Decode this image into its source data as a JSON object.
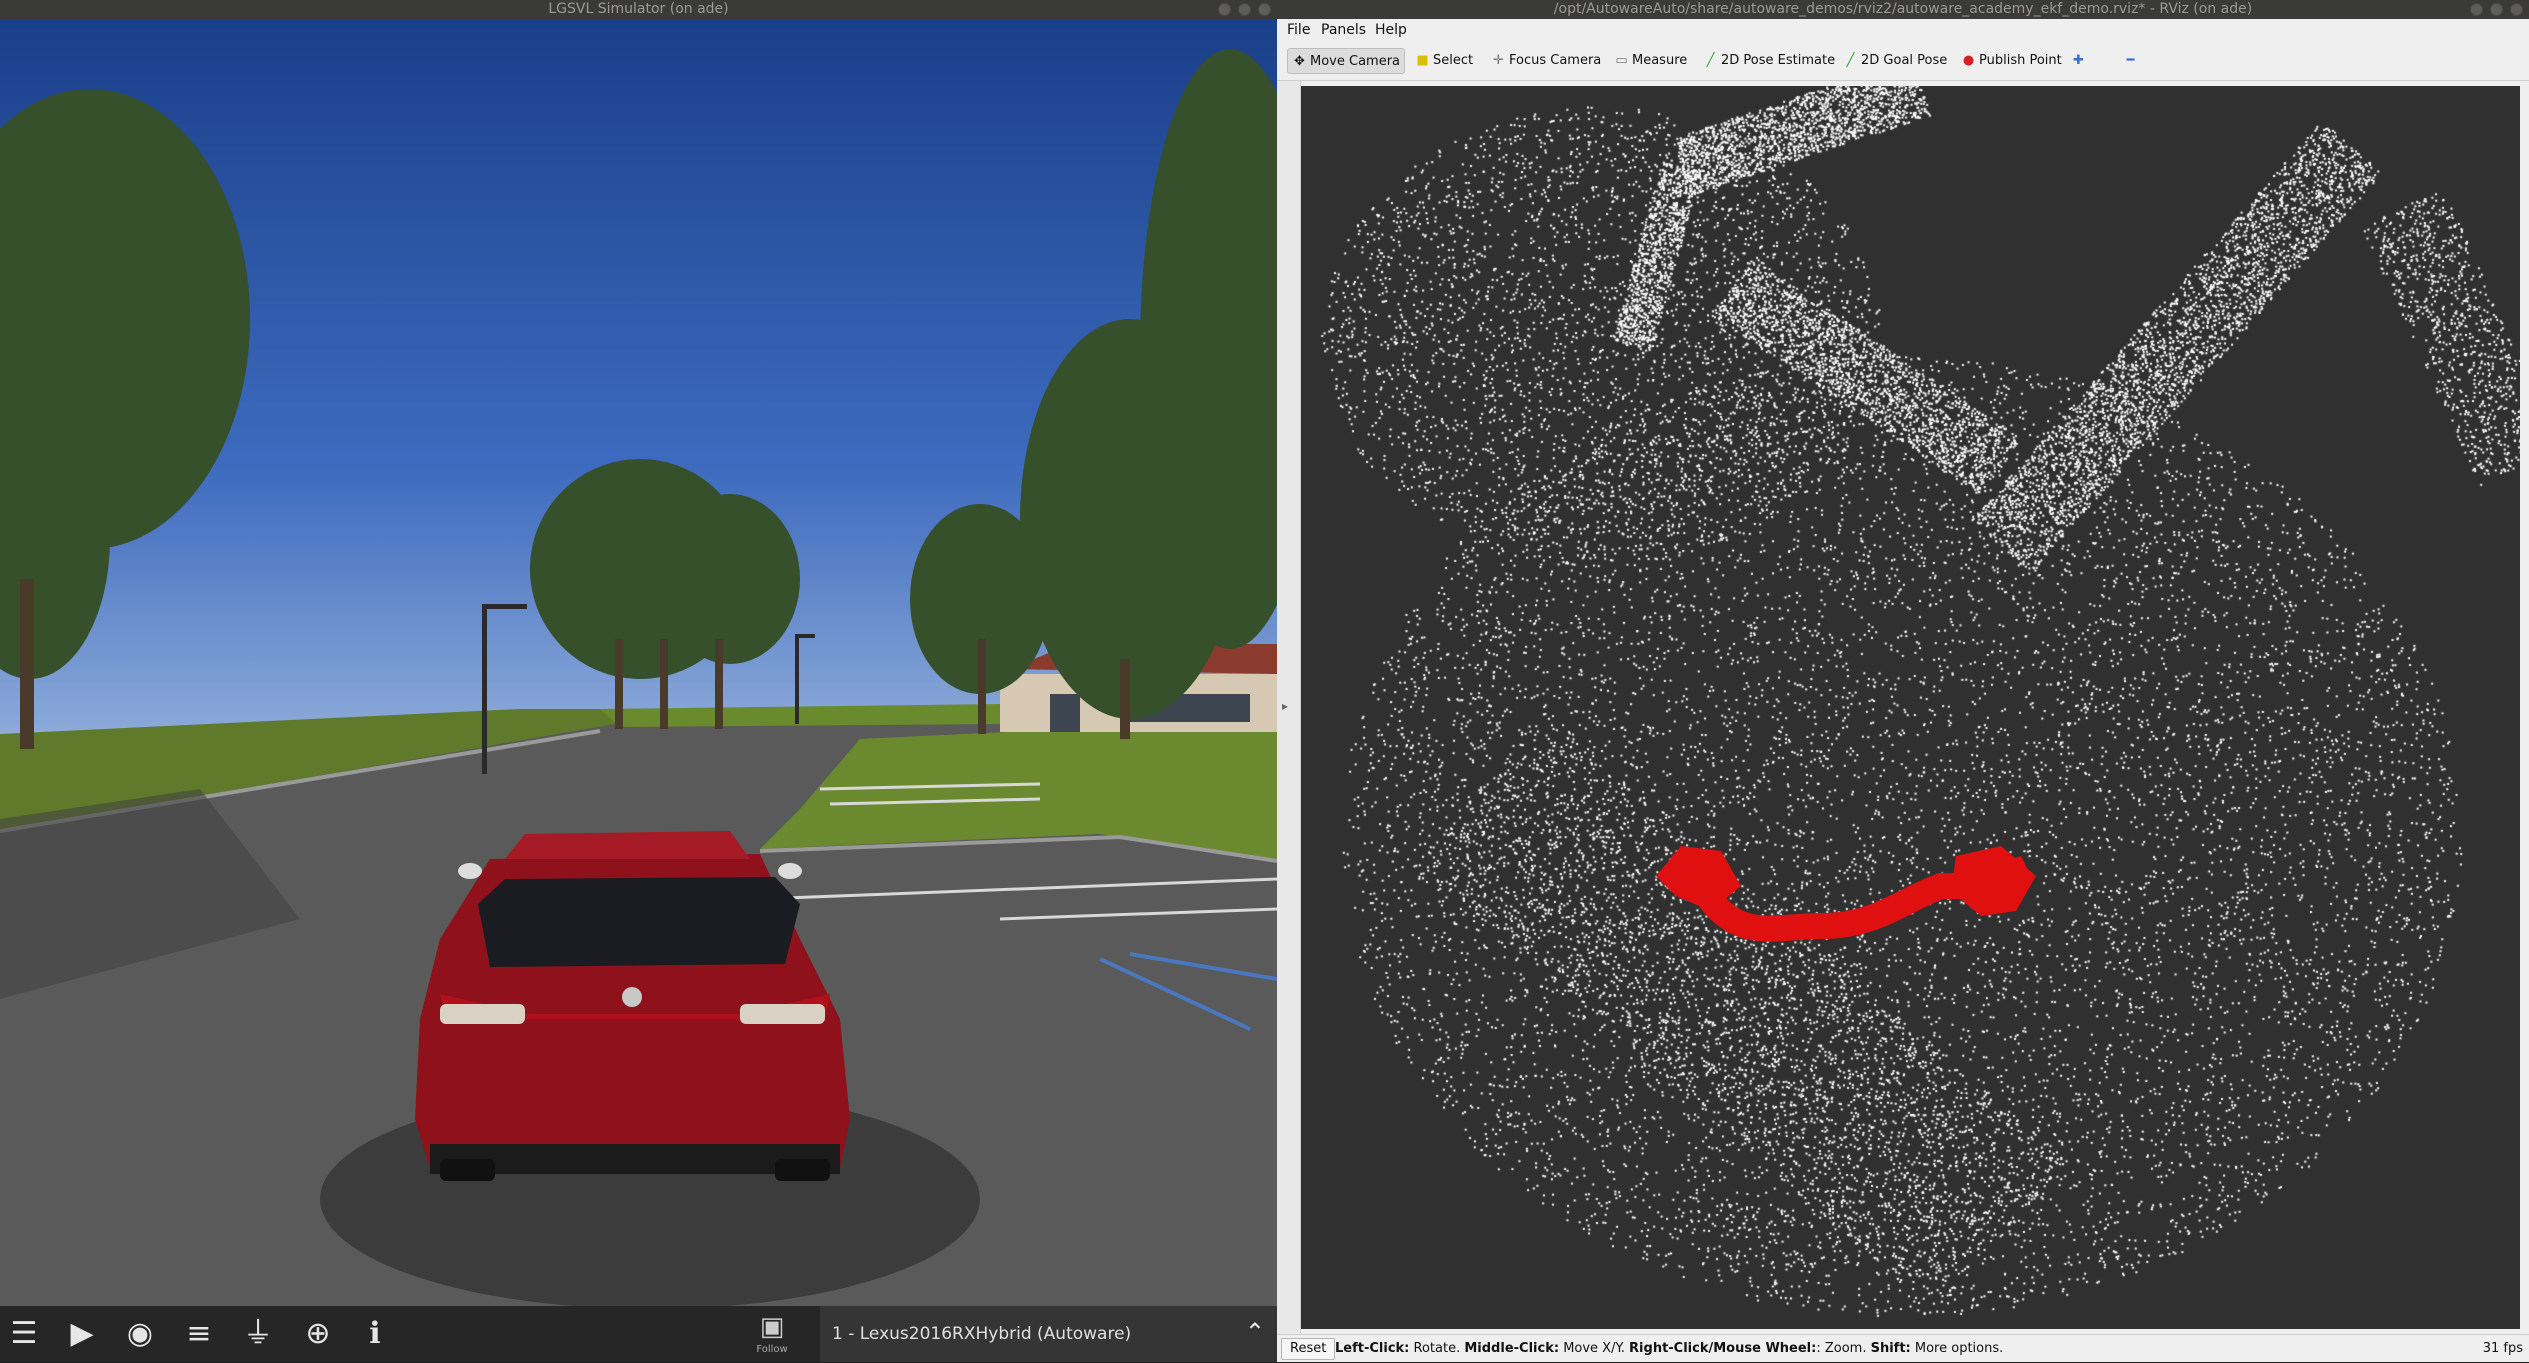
{
  "lgsvl": {
    "title": "LGSVL Simulator (on ade)",
    "follow_label": "Follow",
    "vehicle": "1 - Lexus2016RXHybrid (Autoware)",
    "toolbar_icons": [
      "menu-icon",
      "play-icon",
      "eye-icon",
      "sliders-icon",
      "plug-icon",
      "gamepad-icon",
      "info-icon"
    ]
  },
  "rviz": {
    "title": "/opt/AutowareAuto/share/autoware_demos/rviz2/autoware_academy_ekf_demo.rviz* - RViz (on ade)",
    "menu": [
      "File",
      "Panels",
      "Help"
    ],
    "tools": [
      "Move Camera",
      "Select",
      "Focus Camera",
      "Measure",
      "2D Pose Estimate",
      "2D Goal Pose",
      "Publish Point"
    ],
    "status": {
      "reset": "Reset",
      "left_click": "Left-Click:",
      "left_click_action": "Rotate.",
      "middle_click": "Middle-Click:",
      "middle_click_action": "Move X/Y.",
      "right_click": "Right-Click/Mouse Wheel:",
      "right_click_action": ": Zoom.",
      "shift": "Shift:",
      "shift_action": "More options.",
      "fps": "31 fps"
    }
  },
  "colors": {
    "pointcloud": "#ffffff",
    "trajectory": "#e01010",
    "viewport_bg": "#303030",
    "car_body": "#8e111b"
  }
}
